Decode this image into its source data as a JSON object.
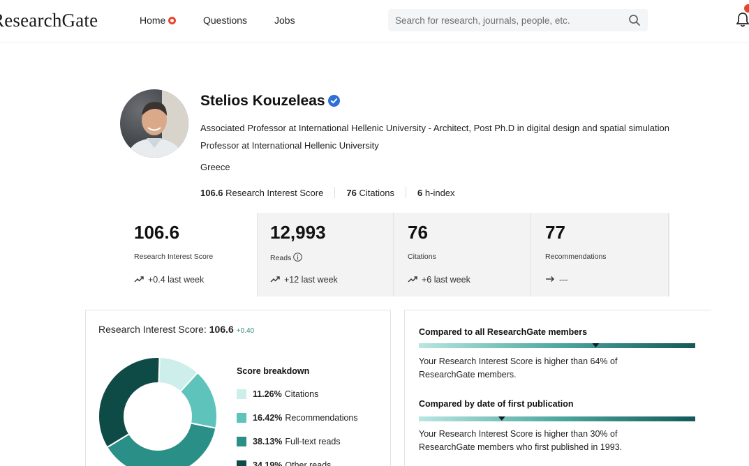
{
  "nav": {
    "logo": "ResearchGate",
    "home": "Home",
    "questions": "Questions",
    "jobs": "Jobs",
    "search_placeholder": "Search for research, journals, people, etc."
  },
  "profile": {
    "name": "Stelios Kouzeleas",
    "headline": "Associated Professor at International Hellenic University - Architect, Post Ph.D in digital design and spatial simulation",
    "position": "Professor at International Hellenic University",
    "country": "Greece",
    "metrics": {
      "ris_value": "106.6",
      "ris_label": "Research Interest Score",
      "citations_value": "76",
      "citations_label": "Citations",
      "hindex_value": "6",
      "hindex_label": "h-index"
    }
  },
  "stats": [
    {
      "value": "106.6",
      "label": "Research Interest Score",
      "trend": "+0.4 last week",
      "trend_icon": "trend-up-icon"
    },
    {
      "value": "12,993",
      "label": "Reads",
      "trend": "+12 last week",
      "trend_icon": "trend-up-icon"
    },
    {
      "value": "76",
      "label": "Citations",
      "trend": "+6 last week",
      "trend_icon": "trend-up-icon"
    },
    {
      "value": "77",
      "label": "Recommendations",
      "trend": "---",
      "trend_icon": "arrow-right-icon"
    }
  ],
  "score_panel": {
    "title": "Research Interest Score:",
    "value": "106.6",
    "delta": "+0.40",
    "breakdown_title": "Score breakdown",
    "breakdown": [
      {
        "pct": "11.26%",
        "label": "Citations",
        "value": 11.26,
        "color": "#cdeeea"
      },
      {
        "pct": "16.42%",
        "label": "Recommendations",
        "value": 16.42,
        "color": "#5ec4bb"
      },
      {
        "pct": "38.13%",
        "label": "Full-text reads",
        "value": 38.13,
        "color": "#2a8f86"
      },
      {
        "pct": "34.19%",
        "label": "Other reads",
        "value": 34.19,
        "color": "#0f4b46"
      }
    ]
  },
  "comparison": {
    "all_title": "Compared to all ResearchGate members",
    "all_pct": 64,
    "all_text_1": "Your Research Interest Score is higher than 64% of",
    "all_text_2": "ResearchGate members.",
    "date_title": "Compared by date of first publication",
    "date_pct": 30,
    "date_text_1": "Your Research Interest Score is higher than 30% of",
    "date_text_2": "ResearchGate members who first published in 1993."
  }
}
